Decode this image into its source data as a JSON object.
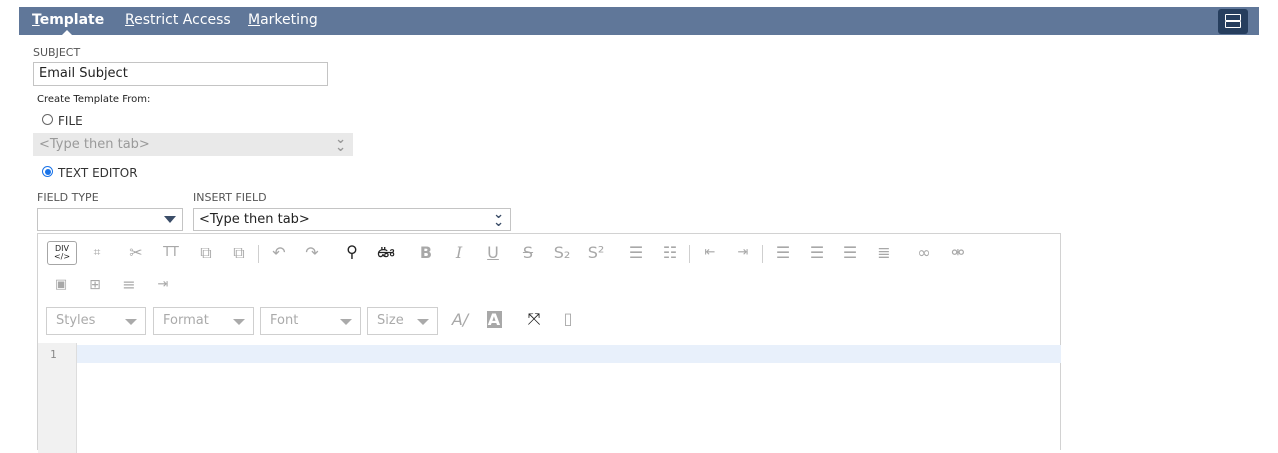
{
  "tabs": [
    {
      "key": "T",
      "rest": "emplate",
      "active": true
    },
    {
      "key": "R",
      "rest": "estrict Access",
      "active": false
    },
    {
      "key": "M",
      "rest": "arketing",
      "active": false
    }
  ],
  "subject": {
    "label": "SUBJECT",
    "value": "Email Subject"
  },
  "create_from": {
    "label": "Create Template From:",
    "file": {
      "label": "FILE",
      "checked": false,
      "placeholder": "<Type then tab>"
    },
    "text_editor": {
      "label": "TEXT EDITOR",
      "checked": true
    }
  },
  "field_type": {
    "label": "FIELD TYPE",
    "value": ""
  },
  "insert_field": {
    "label": "INSERT FIELD",
    "value": "<Type then tab>"
  },
  "editor": {
    "source_button": "DIV\n</>",
    "styles": "Styles",
    "format": "Format",
    "font": "Font",
    "size": "Size",
    "line_numbers": [
      "1"
    ]
  },
  "colors": {
    "tabbar": "#607799",
    "accent": "#263e5e",
    "radio": "#1a73e8"
  }
}
